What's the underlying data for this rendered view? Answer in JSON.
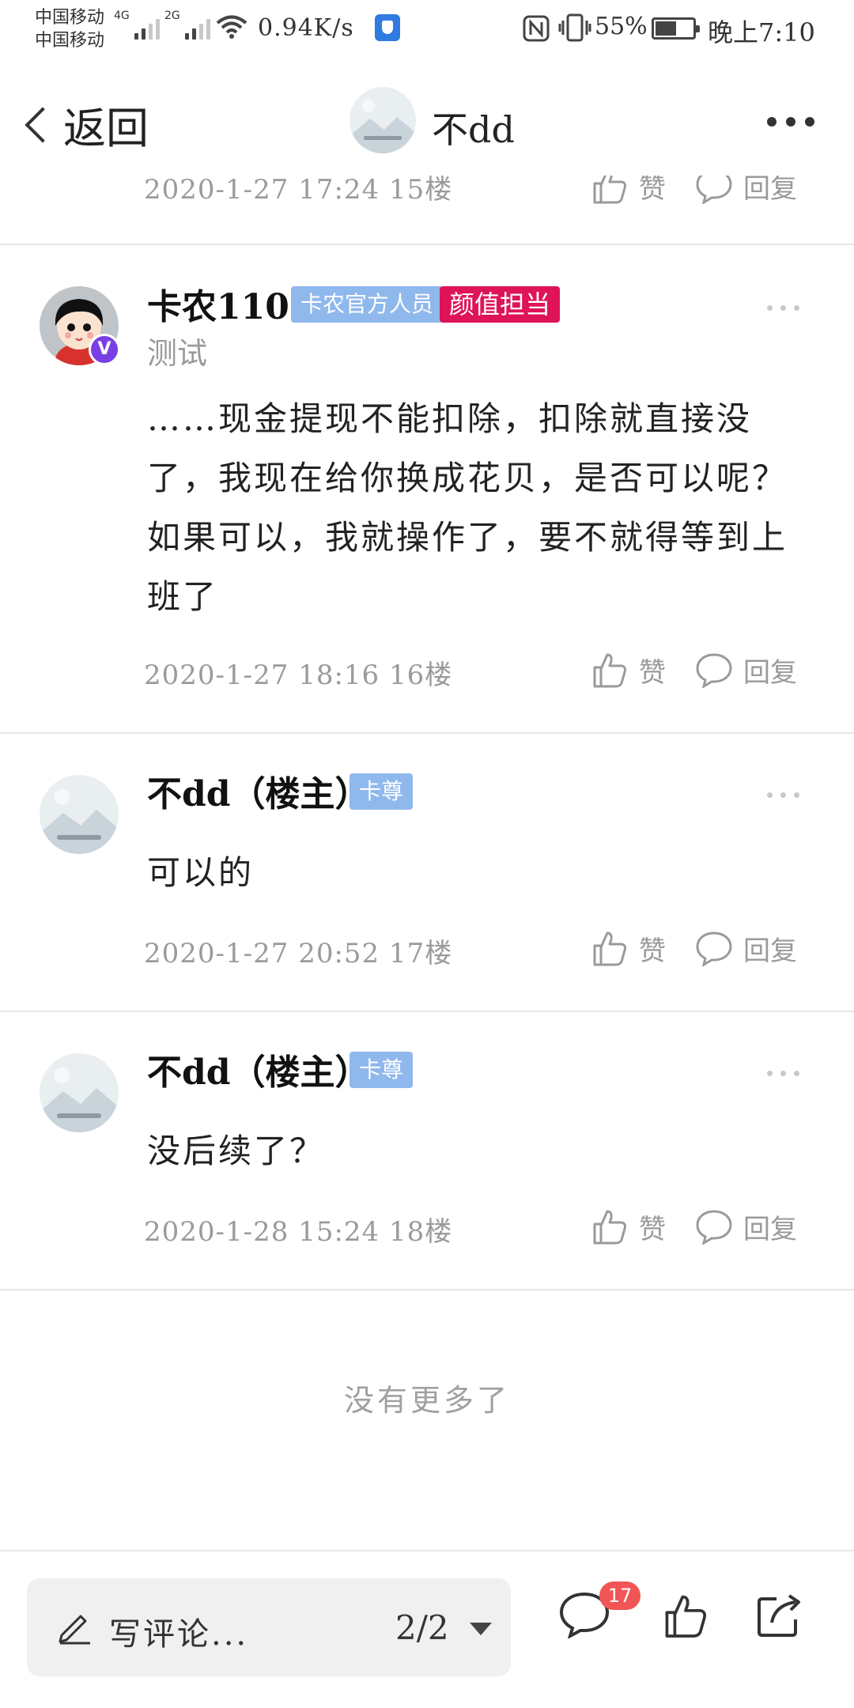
{
  "status_bar": {
    "carrier_1": "中国移动",
    "carrier_2": "中国移动",
    "net_1": "4G",
    "net_2": "2G",
    "speed": "0.94K/s",
    "battery": "55%",
    "time": "晚上7:10"
  },
  "header": {
    "back_label": "返回",
    "title": "不dd"
  },
  "cutoff_post": {
    "meta": "2020-1-27 17:24 15楼",
    "like_label": "赞",
    "reply_label": "回复"
  },
  "posts": [
    {
      "name": "卡农110",
      "tags": [
        "卡农官方人员",
        "颜值担当"
      ],
      "subline": "测试",
      "verified": "V",
      "body": "……现金提现不能扣除，扣除就直接没了，我现在给你换成花贝，是否可以呢？如果可以，我就操作了，要不就得等到上班了",
      "meta": "2020-1-27 18:16 16楼",
      "like_label": "赞",
      "reply_label": "回复"
    },
    {
      "name": "不dd（楼主）",
      "tags": [
        "卡尊"
      ],
      "body": "可以的",
      "meta": "2020-1-27 20:52 17楼",
      "like_label": "赞",
      "reply_label": "回复"
    },
    {
      "name": "不dd（楼主）",
      "tags": [
        "卡尊"
      ],
      "body": "没后续了？",
      "meta": "2020-1-28 15:24 18楼",
      "like_label": "赞",
      "reply_label": "回复"
    }
  ],
  "end_text": "没有更多了",
  "bottom_bar": {
    "comment_placeholder": "写评论...",
    "pager": "2/2",
    "comment_count": "17"
  },
  "colors": {
    "tag_blue": "#8fb8ec",
    "tag_red": "#df1457",
    "badge_red": "#f25555",
    "verified_purple": "#7a3fe4"
  }
}
